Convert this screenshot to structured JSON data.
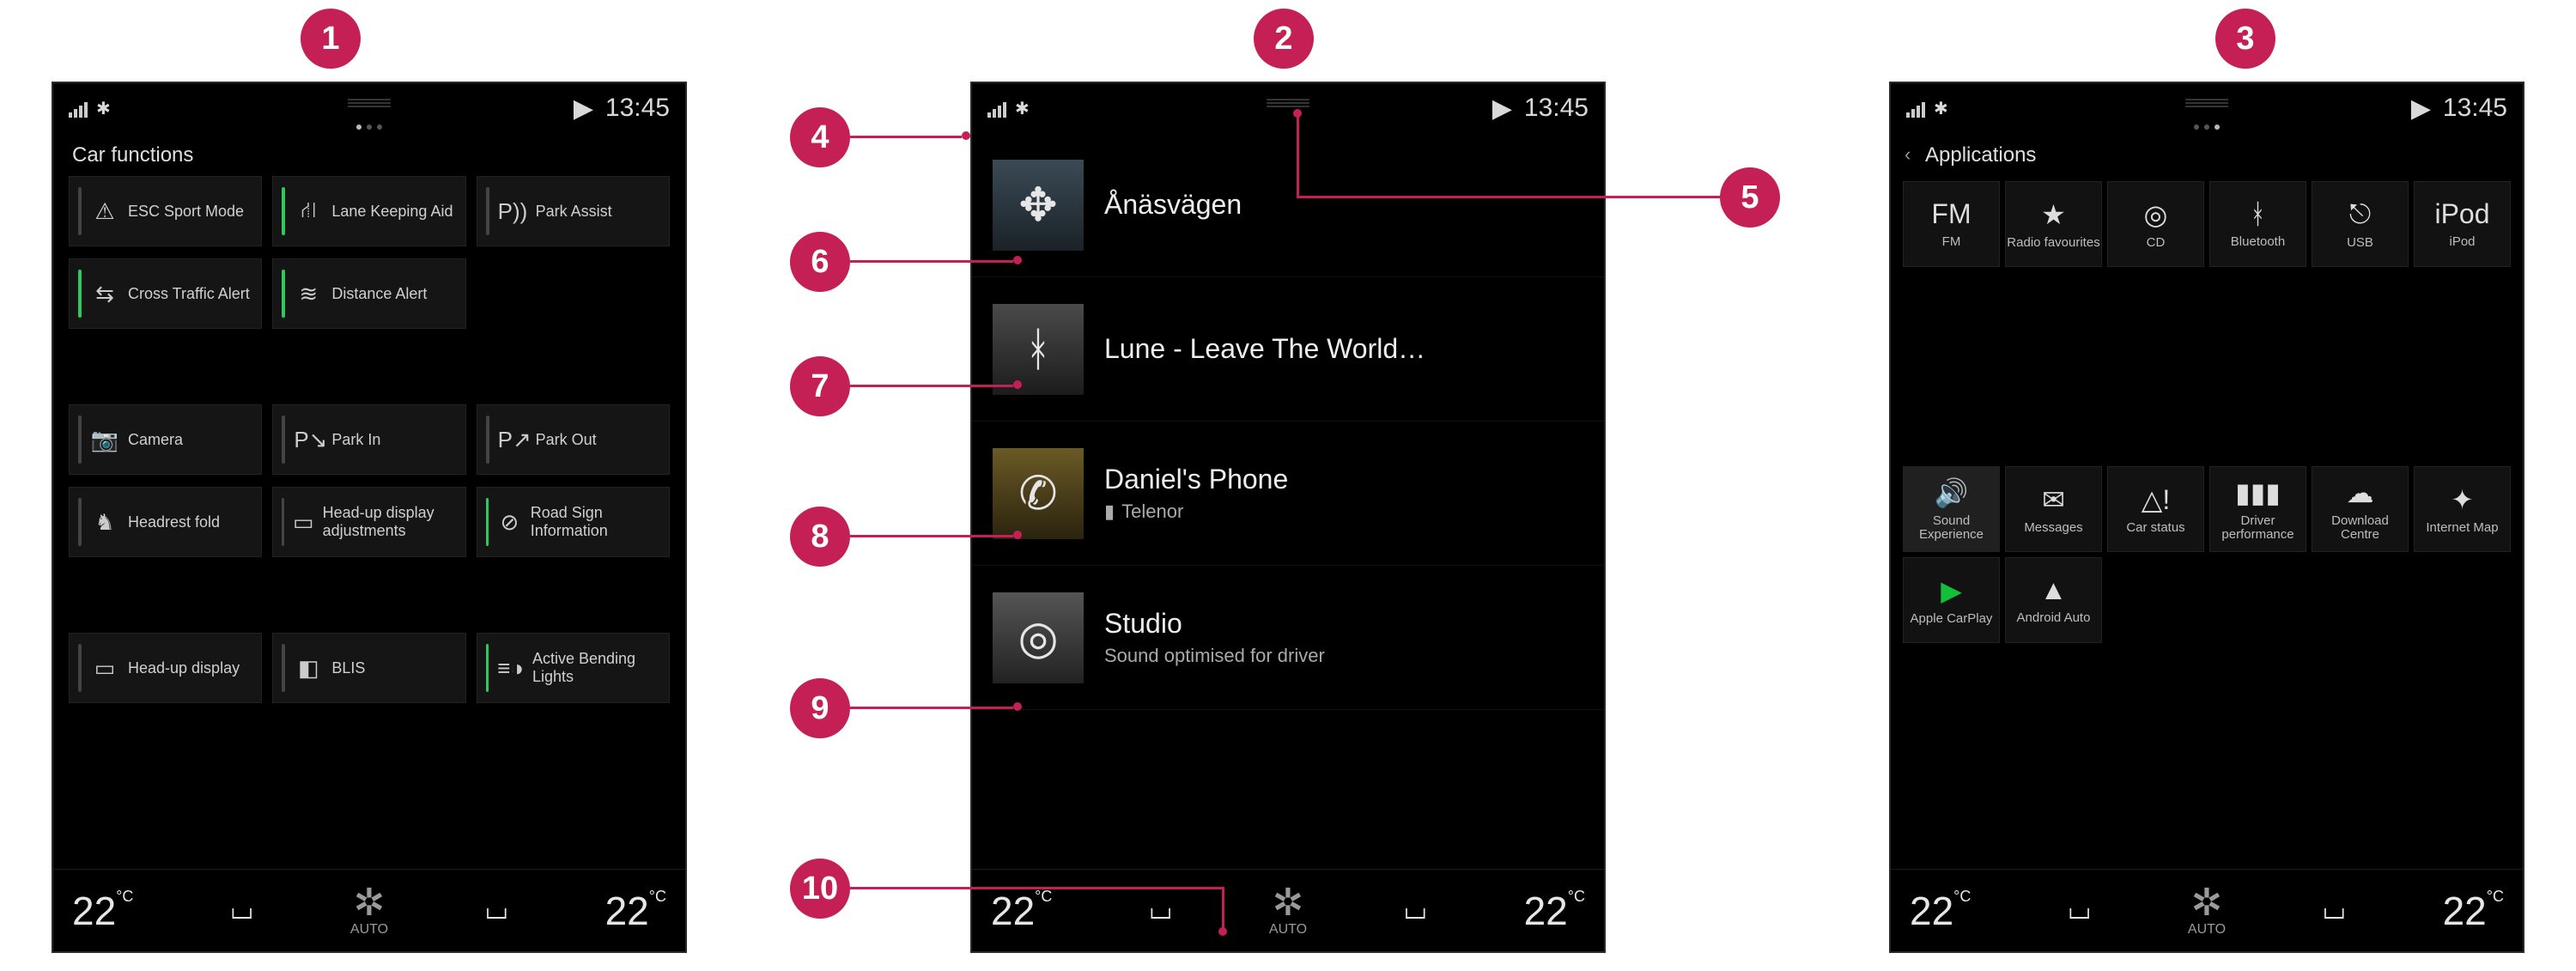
{
  "status": {
    "time": "13:45"
  },
  "climate": {
    "leftTemp": "22",
    "rightTemp": "22",
    "unit": "°C",
    "mode": "AUTO"
  },
  "screen1": {
    "title": "Car functions",
    "rows": [
      [
        {
          "bar": "plain",
          "icon": "esc",
          "label": "ESC Sport Mode"
        },
        {
          "bar": "green",
          "icon": "lka",
          "label": "Lane Keeping Aid"
        },
        {
          "bar": "plain",
          "icon": "park",
          "label": "Park Assist"
        }
      ],
      [
        {
          "bar": "green",
          "icon": "cta",
          "label": "Cross Traffic Alert"
        },
        {
          "bar": "green",
          "icon": "dist",
          "label": "Distance Alert"
        },
        null
      ],
      "gap",
      [
        {
          "bar": "plain",
          "icon": "camera",
          "label": "Camera"
        },
        {
          "bar": "plain",
          "icon": "parkin",
          "label": "Park In"
        },
        {
          "bar": "plain",
          "icon": "parkout",
          "label": "Park Out"
        }
      ],
      [
        {
          "bar": "plain",
          "icon": "headrest",
          "label": "Headrest fold"
        },
        {
          "bar": "plain",
          "icon": "hud",
          "label": "Head-up display adjustments"
        },
        {
          "bar": "green",
          "icon": "rsi",
          "label": "Road Sign Information"
        }
      ],
      "gap",
      [
        {
          "bar": "plain",
          "icon": "huddisp",
          "label": "Head-up display"
        },
        {
          "bar": "plain",
          "icon": "blis",
          "label": "BLIS"
        },
        {
          "bar": "green",
          "icon": "abl",
          "label": "Active Bending Lights"
        }
      ]
    ]
  },
  "screen2": {
    "items": [
      {
        "kind": "nav",
        "title": "Ånäsvägen",
        "sub": ""
      },
      {
        "kind": "bt",
        "title": "Lune - Leave The World…",
        "sub": ""
      },
      {
        "kind": "phone",
        "title": "Daniel's Phone",
        "sub": "Telenor",
        "battery": true
      },
      {
        "kind": "sound",
        "title": "Studio",
        "sub": "Sound optimised for driver"
      }
    ]
  },
  "screen3": {
    "title": "Applications",
    "appsTop": [
      {
        "icon": "fm",
        "label": "FM"
      },
      {
        "icon": "favr",
        "label": "Radio favourites"
      },
      {
        "icon": "cd",
        "label": "CD"
      },
      {
        "icon": "bt",
        "label": "Bluetooth"
      },
      {
        "icon": "usb",
        "label": "USB"
      },
      {
        "icon": "ipod",
        "label": "iPod"
      }
    ],
    "appsBottom": [
      {
        "icon": "sound",
        "label": "Sound Experience",
        "highlight": true
      },
      {
        "icon": "msg",
        "label": "Messages"
      },
      {
        "icon": "status",
        "label": "Car status"
      },
      {
        "icon": "drvperf",
        "label": "Driver performance"
      },
      {
        "icon": "dlc",
        "label": "Download Centre"
      },
      {
        "icon": "imap",
        "label": "Internet Map"
      },
      {
        "icon": "carplay",
        "label": "Apple CarPlay"
      },
      {
        "icon": "aauto",
        "label": "Android Auto"
      }
    ]
  },
  "callouts": {
    "1": "1",
    "2": "2",
    "3": "3",
    "4": "4",
    "5": "5",
    "6": "6",
    "7": "7",
    "8": "8",
    "9": "9",
    "10": "10"
  }
}
